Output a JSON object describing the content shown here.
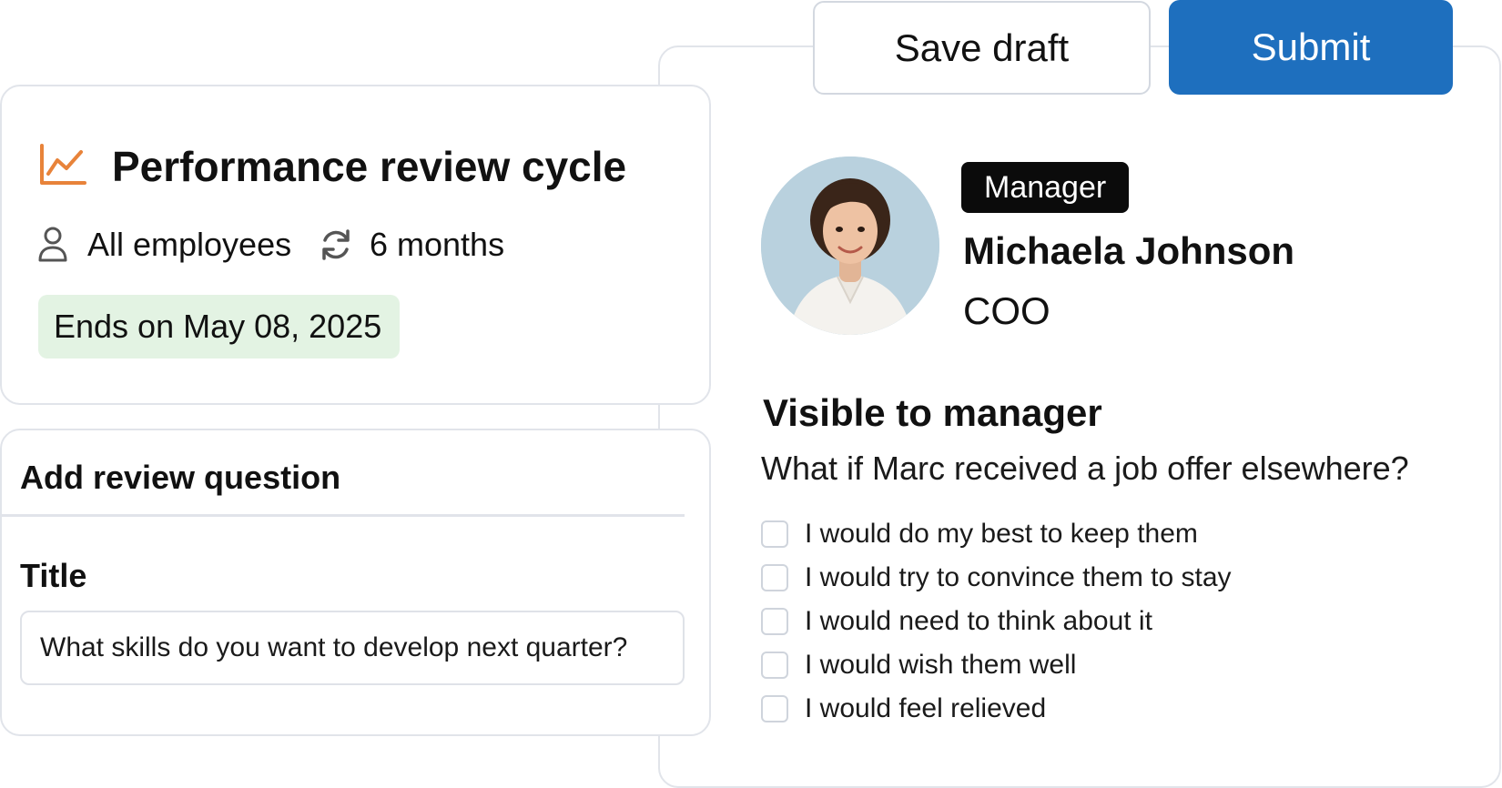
{
  "review": {
    "save_draft_label": "Save draft",
    "submit_label": "Submit",
    "submit_color": "#1e6fbe",
    "role_badge": "Manager",
    "person_name": "Michaela Johnson",
    "person_title": "COO",
    "visibility_heading": "Visible to manager",
    "question": "What if Marc received a job offer elsewhere?",
    "options": [
      "I would do my best to keep them",
      "I would try to convince them to stay",
      "I would need to think about it",
      "I would wish them well",
      "I would feel relieved"
    ]
  },
  "cycle": {
    "icon": "line-chart-icon",
    "icon_color": "#e8833a",
    "title": "Performance review cycle",
    "scope_icon": "person-icon",
    "scope": "All employees",
    "duration_icon": "refresh-icon",
    "duration": "6 months",
    "end_badge": "Ends on May 08, 2025",
    "end_badge_color": "#e3f3e3"
  },
  "question_form": {
    "heading": "Add review question",
    "title_label": "Title",
    "title_value": "What skills do you want to develop next quarter?"
  }
}
